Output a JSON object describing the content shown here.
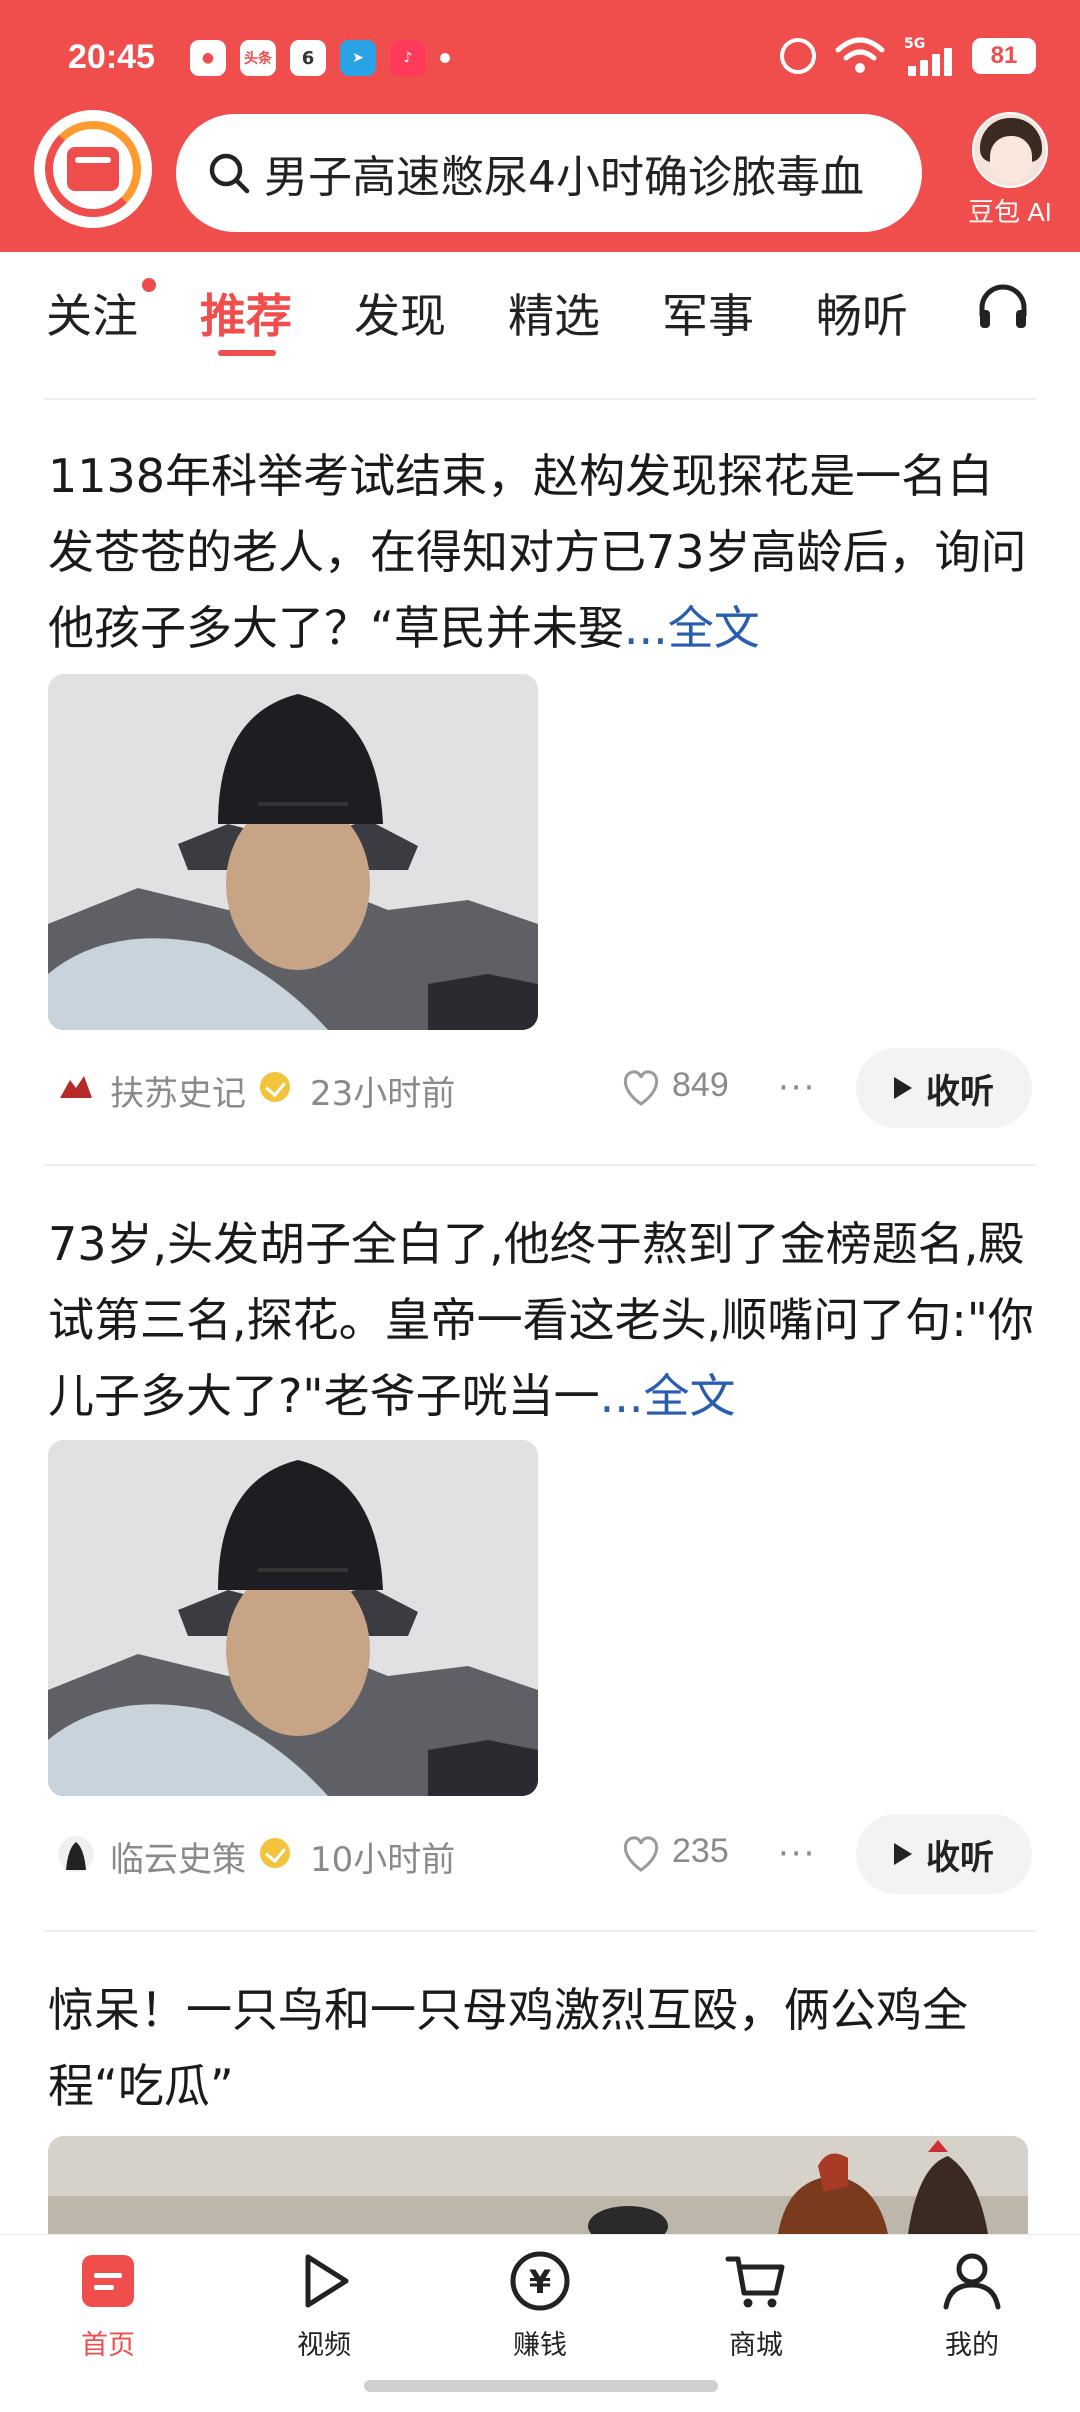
{
  "status_bar": {
    "time": "20:45",
    "app_icons": [
      "头条",
      "6"
    ],
    "network": "5G",
    "battery": "81"
  },
  "search": {
    "query": "男子高速憋尿4小时确诊脓毒血"
  },
  "assistant": {
    "label": "豆包 AI"
  },
  "tabs": [
    {
      "label": "关注"
    },
    {
      "label": "推荐"
    },
    {
      "label": "发现"
    },
    {
      "label": "精选"
    },
    {
      "label": "军事"
    },
    {
      "label": "畅听"
    }
  ],
  "articles": [
    {
      "title": "1138年科举考试结束，赵构发现探花是一名白发苍苍的老人，在得知对方已73岁高龄后，询问他孩子多大了？“草民并未娶",
      "more": "...全文",
      "author": "扶苏史记",
      "time": "23小时前",
      "likes": "849",
      "listen_label": "收听"
    },
    {
      "title": "73岁,头发胡子全白了,他终于熬到了金榜题名,殿试第三名,探花。皇帝一看这老头,顺嘴问了句:\"你儿子多大了?\"老爷子咣当一",
      "more": "...全文",
      "author": "临云史策",
      "time": "10小时前",
      "likes": "235",
      "listen_label": "收听"
    },
    {
      "title": "惊呆！一只鸟和一只母鸡激烈互殴，俩公鸡全程“吃瓜”"
    }
  ],
  "bottom_nav": [
    {
      "label": "首页",
      "icon": "home-icon",
      "active": true
    },
    {
      "label": "视频",
      "icon": "play-icon"
    },
    {
      "label": "赚钱",
      "icon": "yuan-icon"
    },
    {
      "label": "商城",
      "icon": "cart-icon"
    },
    {
      "label": "我的",
      "icon": "profile-icon"
    }
  ],
  "colors": {
    "brand_red": "#f04e4c",
    "link_blue": "#2a5db0",
    "meta_gray": "#8a8a8a"
  }
}
